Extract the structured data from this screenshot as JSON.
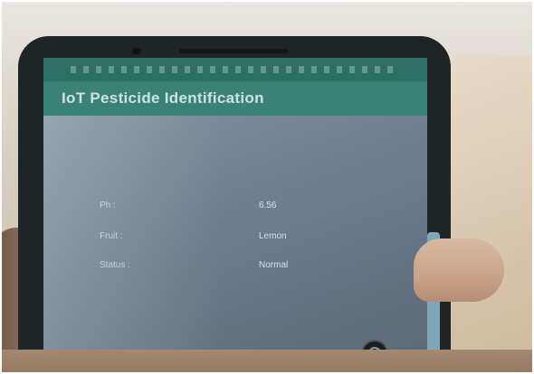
{
  "app": {
    "title": "IoT Pesticide Identification"
  },
  "readings": [
    {
      "label": "Ph :",
      "value": "6.56"
    },
    {
      "label": "Fruit :",
      "value": "Lemon"
    },
    {
      "label": "Status :",
      "value": "Normal"
    }
  ],
  "colors": {
    "app_bar": "#3a8276",
    "status_bar": "#2e6f64",
    "screen_bg": "#6f7f90"
  },
  "icons": {
    "front_camera": "camera-icon",
    "floating_button": "circle-button-icon"
  }
}
